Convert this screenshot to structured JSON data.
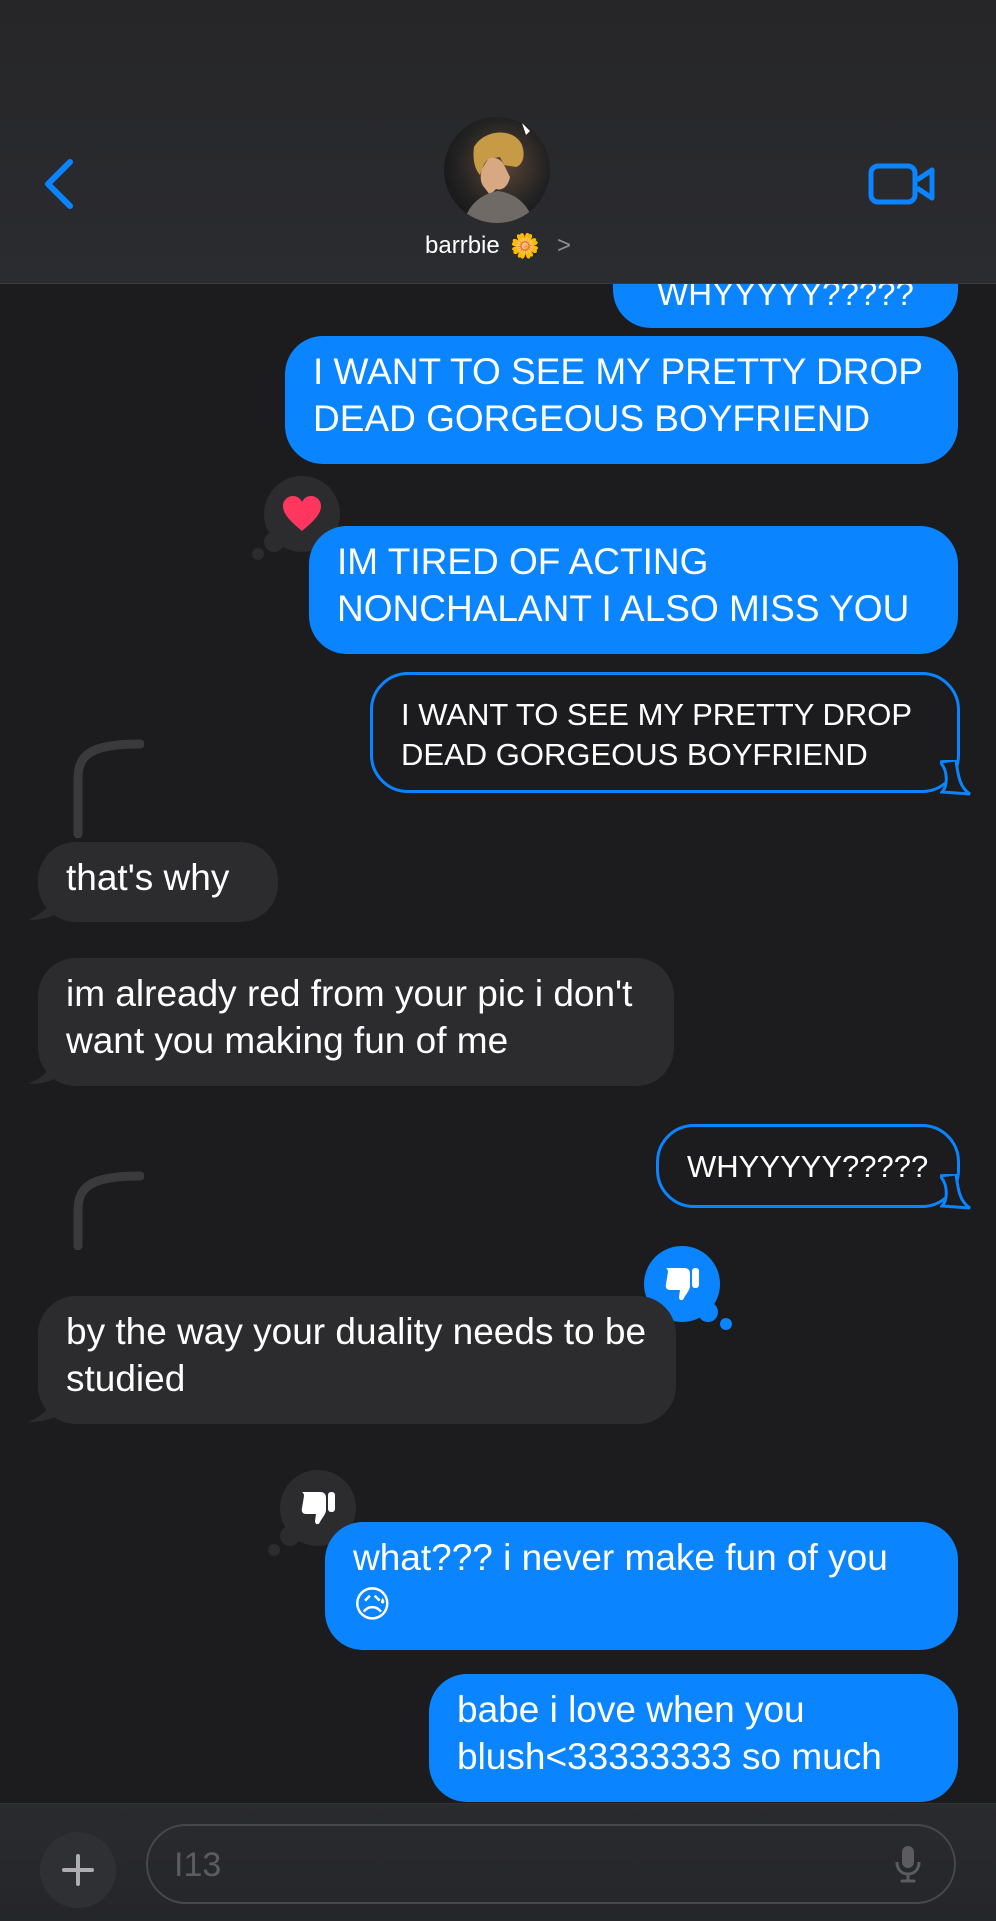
{
  "header": {
    "contact_name": "barrbie",
    "contact_emoji": "🌼",
    "chevron": ">"
  },
  "messages": [
    {
      "from": "me",
      "text": "WHYYYYY?????"
    },
    {
      "from": "me",
      "text": "I WANT TO SEE MY PRETTY DROP DEAD GORGEOUS BOYFRIEND"
    },
    {
      "from": "me",
      "text": "IM TIRED OF ACTING NONCHALANT I ALSO MISS YOU",
      "tapback": "heart"
    },
    {
      "from": "me",
      "type": "quoted",
      "text": "I WANT TO SEE MY PRETTY DROP DEAD GORGEOUS BOYFRIEND"
    },
    {
      "from": "them",
      "text": "that's why"
    },
    {
      "from": "them",
      "text": "im already red from your pic i don't want you making fun of me"
    },
    {
      "from": "me",
      "type": "quoted",
      "text": "WHYYYYY?????"
    },
    {
      "from": "them",
      "text": "by the way your duality needs to be studied",
      "tapback": "thumbs-down"
    },
    {
      "from": "me",
      "text": "what??? i never make fun of you",
      "emoji": "😥",
      "tapback": "thumbs-down"
    },
    {
      "from": "me",
      "text": "babe i love when you blush<33333333 so much"
    }
  ],
  "composer": {
    "input_value": "I13"
  },
  "colors": {
    "sent": "#0b84ff",
    "received": "#2c2c2e",
    "background": "#1c1c1e",
    "heart": "#ff375f"
  },
  "icons": [
    "back-chevron-icon",
    "video-camera-icon",
    "heart-icon",
    "thumbs-down-icon",
    "plus-icon",
    "microphone-icon"
  ]
}
